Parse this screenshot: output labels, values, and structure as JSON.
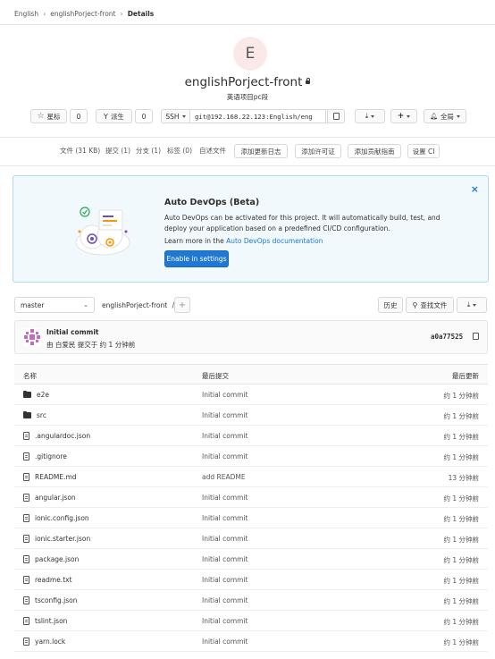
{
  "breadcrumb": {
    "items": [
      "English",
      "englishPorject-front",
      "Details"
    ]
  },
  "project": {
    "avatar_letter": "E",
    "name": "englishPorject-front",
    "description": "英语项目pc段"
  },
  "actions": {
    "star_label": "星标",
    "star_count": "0",
    "fork_label": "派生",
    "fork_count": "0",
    "protocol": "SSH",
    "clone_url": "git@192.168.22.123:English/eng",
    "notify_label": "全局"
  },
  "stats": {
    "files": "文件 (31 KB)",
    "commits": "提交 (1)",
    "branches": "分支 (1)",
    "tags": "标签 (0)",
    "custom": "自述文件",
    "add_changelog": "添加更新日志",
    "add_license": "添加许可证",
    "add_contributing": "添加贡献指南",
    "setup_ci": "设置 CI"
  },
  "devops": {
    "title": "Auto DevOps (Beta)",
    "text": "Auto DevOps can be activated for this project. It will automatically build, test, and deploy your application based on a predefined CI/CD configuration.",
    "learn_prefix": "Learn more in the ",
    "learn_link": "Auto DevOps documentation",
    "button": "Enable in settings"
  },
  "tree": {
    "branch": "master",
    "path": "englishPorject-front",
    "path_sep": "/",
    "history": "历史",
    "find_file": "查找文件"
  },
  "commit": {
    "title": "Initial commit",
    "meta": "由 白爱民 提交于 约 1 分钟前",
    "sha": "a0a77525"
  },
  "table": {
    "headers": {
      "name": "名称",
      "last_commit": "最后提交",
      "last_update": "最后更新"
    },
    "rows": [
      {
        "name": "e2e",
        "type": "folder",
        "commit": "Initial commit",
        "time": "约 1 分钟前"
      },
      {
        "name": "src",
        "type": "folder",
        "commit": "Initial commit",
        "time": "约 1 分钟前"
      },
      {
        "name": ".angulardoc.json",
        "type": "file",
        "commit": "Initial commit",
        "time": "约 1 分钟前"
      },
      {
        "name": ".gitignore",
        "type": "file",
        "commit": "Initial commit",
        "time": "约 1 分钟前"
      },
      {
        "name": "README.md",
        "type": "file",
        "commit": "add README",
        "time": "13 分钟前"
      },
      {
        "name": "angular.json",
        "type": "file",
        "commit": "Initial commit",
        "time": "约 1 分钟前"
      },
      {
        "name": "ionic.config.json",
        "type": "file",
        "commit": "Initial commit",
        "time": "约 1 分钟前"
      },
      {
        "name": "ionic.starter.json",
        "type": "file",
        "commit": "Initial commit",
        "time": "约 1 分钟前"
      },
      {
        "name": "package.json",
        "type": "file",
        "commit": "Initial commit",
        "time": "约 1 分钟前"
      },
      {
        "name": "readme.txt",
        "type": "file",
        "commit": "Initial commit",
        "time": "约 1 分钟前"
      },
      {
        "name": "tsconfig.json",
        "type": "file",
        "commit": "Initial commit",
        "time": "约 1 分钟前"
      },
      {
        "name": "tslint.json",
        "type": "file",
        "commit": "Initial commit",
        "time": "约 1 分钟前"
      },
      {
        "name": "yarn.lock",
        "type": "file",
        "commit": "Initial commit",
        "time": "约 1 分钟前"
      }
    ]
  },
  "colors": {
    "primary": "#1f78d1",
    "banner_bg": "#f2f9fc",
    "banner_border": "#b5dbeb",
    "avatar_bg": "#fbe9e7"
  }
}
